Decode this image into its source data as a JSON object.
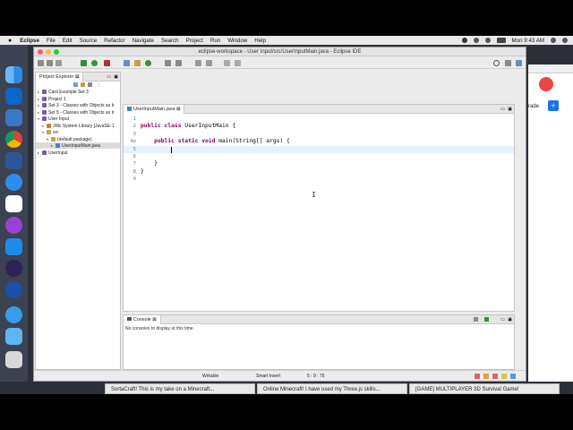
{
  "menubar": {
    "apple": "",
    "app_name": "Eclipse",
    "items": [
      "File",
      "Edit",
      "Source",
      "Refactor",
      "Navigate",
      "Search",
      "Project",
      "Run",
      "Window",
      "Help"
    ],
    "clock": "Mon 9:43 AM"
  },
  "window": {
    "title": "eclipse-workspace - User Input/src/UserInputMain.java - Eclipse IDE"
  },
  "project_explorer": {
    "tab_label": "Project Explorer",
    "items": [
      {
        "label": "Card Example Set 3",
        "depth": 0,
        "toggle": "▸",
        "icon_color": "#7a5aa6"
      },
      {
        "label": "Project 1",
        "depth": 0,
        "toggle": "▸",
        "icon_color": "#7a5aa6"
      },
      {
        "label": "Set 3 - Classes with Objects as Ir",
        "depth": 0,
        "toggle": "▸",
        "icon_color": "#7a5aa6"
      },
      {
        "label": "Set 5 - Classes with Objects as Ir",
        "depth": 0,
        "toggle": "▸",
        "icon_color": "#7a5aa6"
      },
      {
        "label": "User Input",
        "depth": 0,
        "toggle": "▾",
        "icon_color": "#7a5aa6"
      },
      {
        "label": "JRE System Library [JavaSE-1",
        "depth": 1,
        "toggle": "▸",
        "icon_color": "#b58b3a"
      },
      {
        "label": "src",
        "depth": 1,
        "toggle": "▾",
        "icon_color": "#c9a046"
      },
      {
        "label": "(default package)",
        "depth": 2,
        "toggle": "▾",
        "icon_color": "#c9a046"
      },
      {
        "label": "UserInputMain.java",
        "depth": 3,
        "toggle": "▸",
        "icon_color": "#4a7fc1"
      },
      {
        "label": "UserInput",
        "depth": 0,
        "toggle": "▸",
        "icon_color": "#7a5aa6"
      }
    ]
  },
  "editor": {
    "tab_label": "UserInputMain.java",
    "lines": [
      {
        "num": "1",
        "text": ""
      },
      {
        "num": "2",
        "kw": "public class ",
        "text": "UserInputMain {"
      },
      {
        "num": "3",
        "text": ""
      },
      {
        "num": "4⊖",
        "kw": "    public static void ",
        "text": "main(String[] args) {"
      },
      {
        "num": "5",
        "text": "        "
      },
      {
        "num": "6",
        "text": ""
      },
      {
        "num": "7",
        "text": "    }"
      },
      {
        "num": "8",
        "text": "}"
      },
      {
        "num": "9",
        "text": ""
      }
    ]
  },
  "console": {
    "tab_label": "Console",
    "message": "No consoles to display at this time."
  },
  "status": {
    "writable": "Writable",
    "insert_mode": "Smart Insert",
    "position": "5 : 9 : 75"
  },
  "taskbar": [
    "SortaCraft! This is my take on a Minecraft...",
    "Online Minecraft! I have used my Three.js skills...",
    "[GAME] MULTIPLAYER 3D Survival Game!"
  ],
  "right_window": {
    "partial_text": "rade"
  },
  "colors": {
    "keyword": "#7f0055",
    "current_line": "#e8f2fe",
    "accent_blue": "#1a73e8"
  }
}
